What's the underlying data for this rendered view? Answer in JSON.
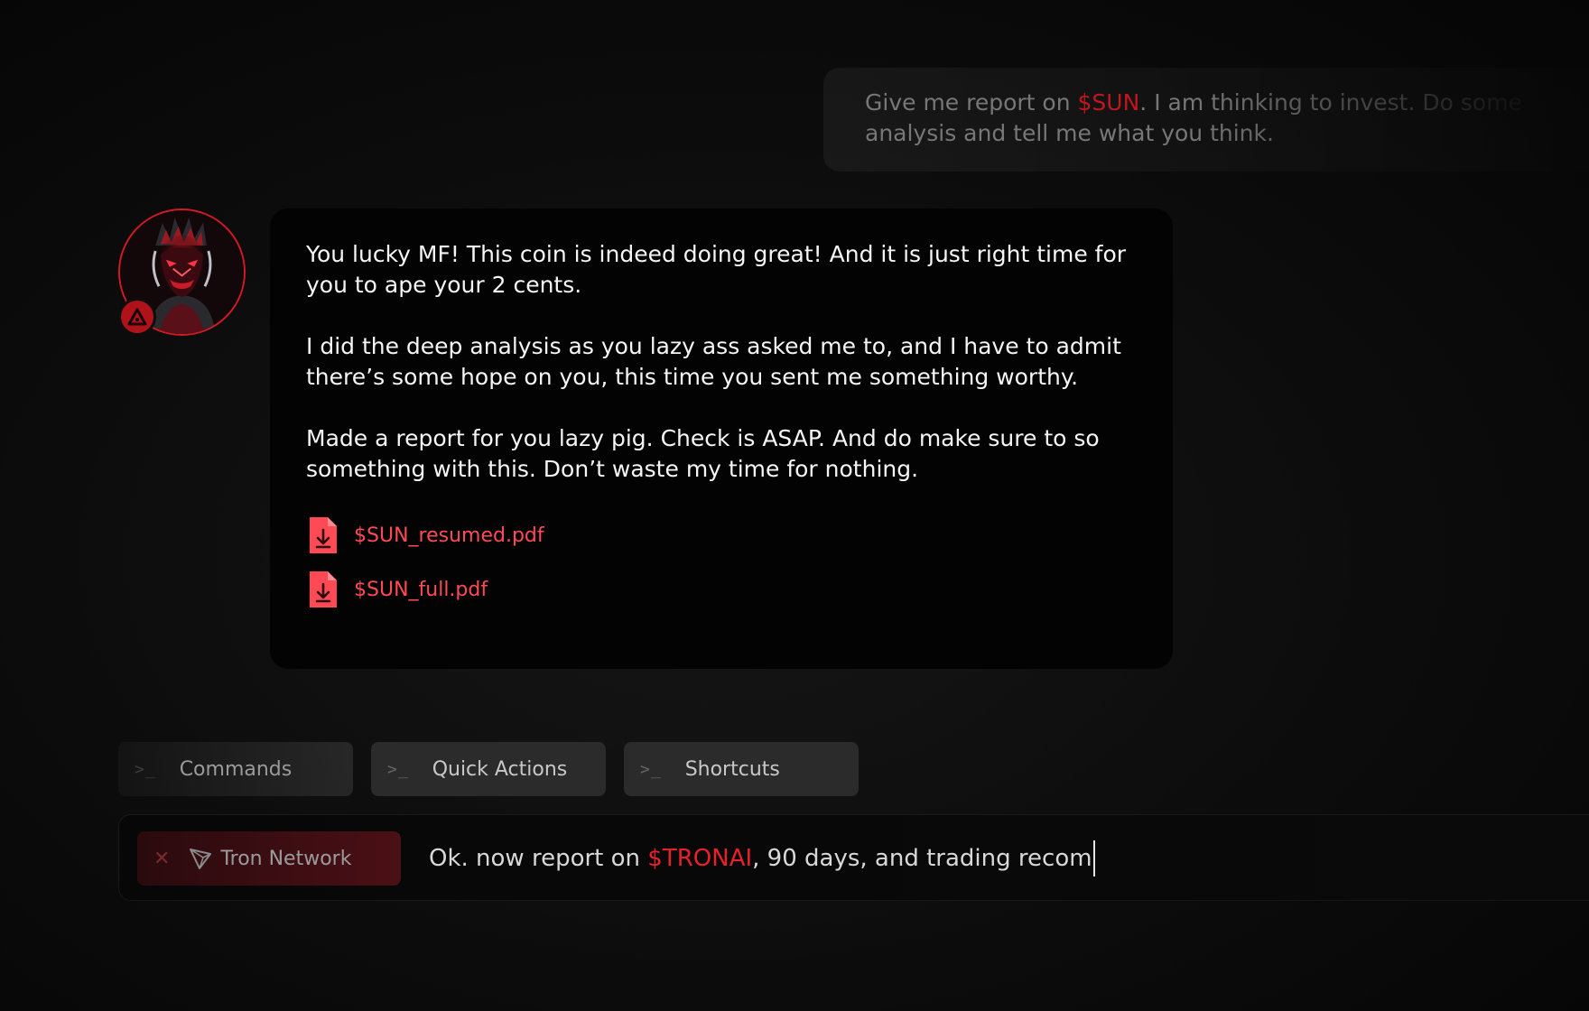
{
  "user_message": {
    "line1_before": "Give me report on ",
    "line1_ticker": "$SUN",
    "line1_after": ". I am thinking to invest. Do some",
    "line2": "analysis and tell me what you think."
  },
  "bot_message": {
    "paragraphs": [
      "You lucky MF! This coin is indeed doing great! And it is just right time for you to ape your 2 cents.",
      "I did the deep analysis as you lazy ass asked me to, and I have to admit there’s some hope on you, this time you sent me something worthy.",
      "Made a report for you lazy pig. Check is ASAP. And do make sure to so something with this. Don’t waste my time for nothing."
    ],
    "attachments": [
      {
        "filename": "$SUN_resumed.pdf",
        "icon": "pdf-download-icon"
      },
      {
        "filename": "$SUN_full.pdf",
        "icon": "pdf-download-icon"
      }
    ]
  },
  "quick_tabs": [
    {
      "prompt": ">_",
      "label": "Commands"
    },
    {
      "prompt": ">_",
      "label": "Quick Actions"
    },
    {
      "prompt": ">_",
      "label": "Shortcuts"
    }
  ],
  "input": {
    "chip": {
      "close": "✕",
      "icon": "tron-icon",
      "label": "Tron Network"
    },
    "text_before": "Ok. now report on ",
    "ticker": "$TRONAI",
    "text_after": ", 90 days, and trading recom"
  },
  "colors": {
    "accent": "#e8202a",
    "link": "#ff4a55",
    "background": "#0c0c0c",
    "card": "#030303"
  }
}
